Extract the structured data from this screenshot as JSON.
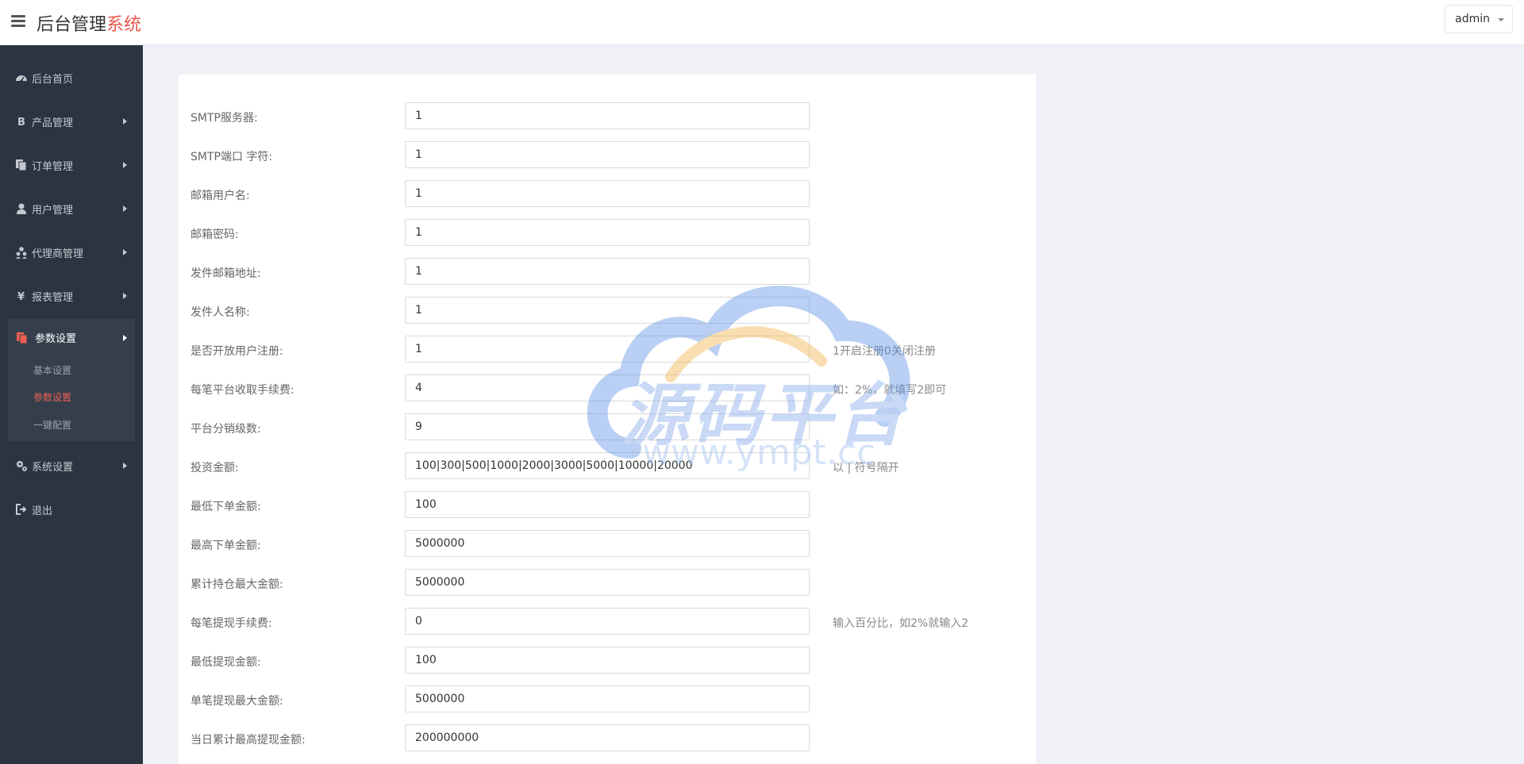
{
  "header": {
    "brand_main": "后台管理",
    "brand_accent": "系统",
    "user_menu": "admin"
  },
  "sidebar": {
    "items": [
      {
        "label": "后台首页",
        "icon": "dashboard-icon"
      },
      {
        "label": "产品管理",
        "icon": "bitcoin-icon"
      },
      {
        "label": "订单管理",
        "icon": "copy-icon"
      },
      {
        "label": "用户管理",
        "icon": "user-icon"
      },
      {
        "label": "代理商管理",
        "icon": "users-icon"
      },
      {
        "label": "报表管理",
        "icon": "yen-icon"
      },
      {
        "label": "参数设置",
        "icon": "copy-icon"
      },
      {
        "label": "系统设置",
        "icon": "gears-icon"
      },
      {
        "label": "退出",
        "icon": "sign-out-icon"
      }
    ],
    "submenu": [
      "基本设置",
      "参数设置",
      "一键配置"
    ],
    "active_submenu": "参数设置"
  },
  "form": {
    "fields": [
      {
        "label": "SMTP服务器:",
        "value": "1",
        "hint": ""
      },
      {
        "label": "SMTP端口 字符:",
        "value": "1",
        "hint": ""
      },
      {
        "label": "邮箱用户名:",
        "value": "1",
        "hint": ""
      },
      {
        "label": "邮箱密码:",
        "value": "1",
        "hint": ""
      },
      {
        "label": "发件邮箱地址:",
        "value": "1",
        "hint": ""
      },
      {
        "label": "发件人名称:",
        "value": "1",
        "hint": ""
      },
      {
        "label": "是否开放用户注册:",
        "value": "1",
        "hint": "1开启注册0关闭注册"
      },
      {
        "label": "每笔平台收取手续费:",
        "value": "4",
        "hint": "如：2%，就填写2即可"
      },
      {
        "label": "平台分销级数:",
        "value": "9",
        "hint": ""
      },
      {
        "label": "投资金额:",
        "value": "100|300|500|1000|2000|3000|5000|10000|20000",
        "hint": "以 | 符号隔开"
      },
      {
        "label": "最低下单金额:",
        "value": "100",
        "hint": ""
      },
      {
        "label": "最高下单金额:",
        "value": "5000000",
        "hint": ""
      },
      {
        "label": "累计持仓最大金额:",
        "value": "5000000",
        "hint": ""
      },
      {
        "label": "每笔提现手续费:",
        "value": "0",
        "hint": "输入百分比，如2%就输入2"
      },
      {
        "label": "最低提现金额:",
        "value": "100",
        "hint": ""
      },
      {
        "label": "单笔提现最大金额:",
        "value": "5000000",
        "hint": ""
      },
      {
        "label": "当日累计最高提现金额:",
        "value": "200000000",
        "hint": ""
      }
    ]
  },
  "watermark": {
    "text": "源码平台",
    "url": "www.ympt.cc"
  }
}
